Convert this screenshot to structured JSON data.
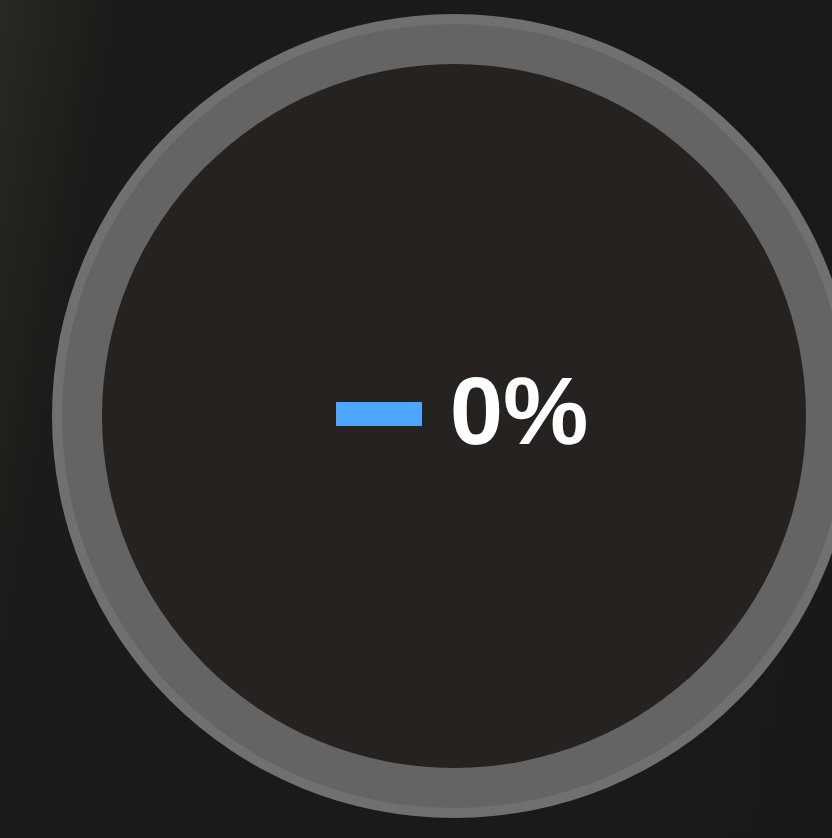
{
  "progress": {
    "level": 0,
    "reading": "0%"
  }
}
